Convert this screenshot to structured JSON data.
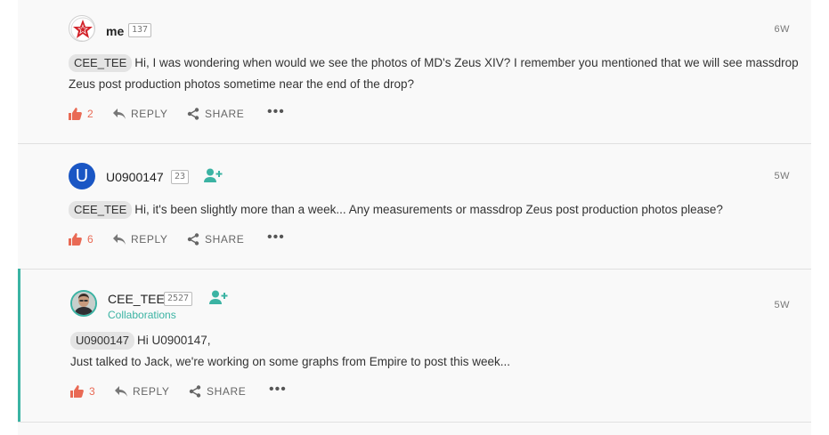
{
  "comments": [
    {
      "username": "me",
      "rep": "137",
      "time": "6W",
      "mention": "CEE_TEE",
      "body": "Hi, I was wondering when would we see the photos of MD's Zeus XIV? I remember you mentioned that we will see massdrop Zeus post production photos sometime near the end of the drop?",
      "likes": "2",
      "reply_label": "REPLY",
      "share_label": "SHARE",
      "avatar_icon": "red-star-icon"
    },
    {
      "username": "U0900147",
      "rep": "23",
      "time": "5W",
      "mention": "CEE_TEE",
      "body": "Hi, it's been slightly more than a week... Any measurements or massdrop Zeus post production photos please?",
      "likes": "6",
      "reply_label": "REPLY",
      "share_label": "SHARE",
      "avatar_letter": "U",
      "follow_icon": "follow-user-icon"
    },
    {
      "username": "CEE_TEE",
      "rep": "2527",
      "role": "Collaborations",
      "time": "5W",
      "mention": "U0900147",
      "body_line1": "Hi U0900147,",
      "body_line2": "Just talked to Jack, we're working on some graphs from Empire to post this week...",
      "likes": "3",
      "reply_label": "REPLY",
      "share_label": "SHARE",
      "avatar_icon": "user-photo-icon",
      "follow_icon": "follow-user-icon"
    }
  ],
  "colors": {
    "accent": "#3bb3a3",
    "like": "#e96a55",
    "avatar_blue": "#1a56c4"
  }
}
